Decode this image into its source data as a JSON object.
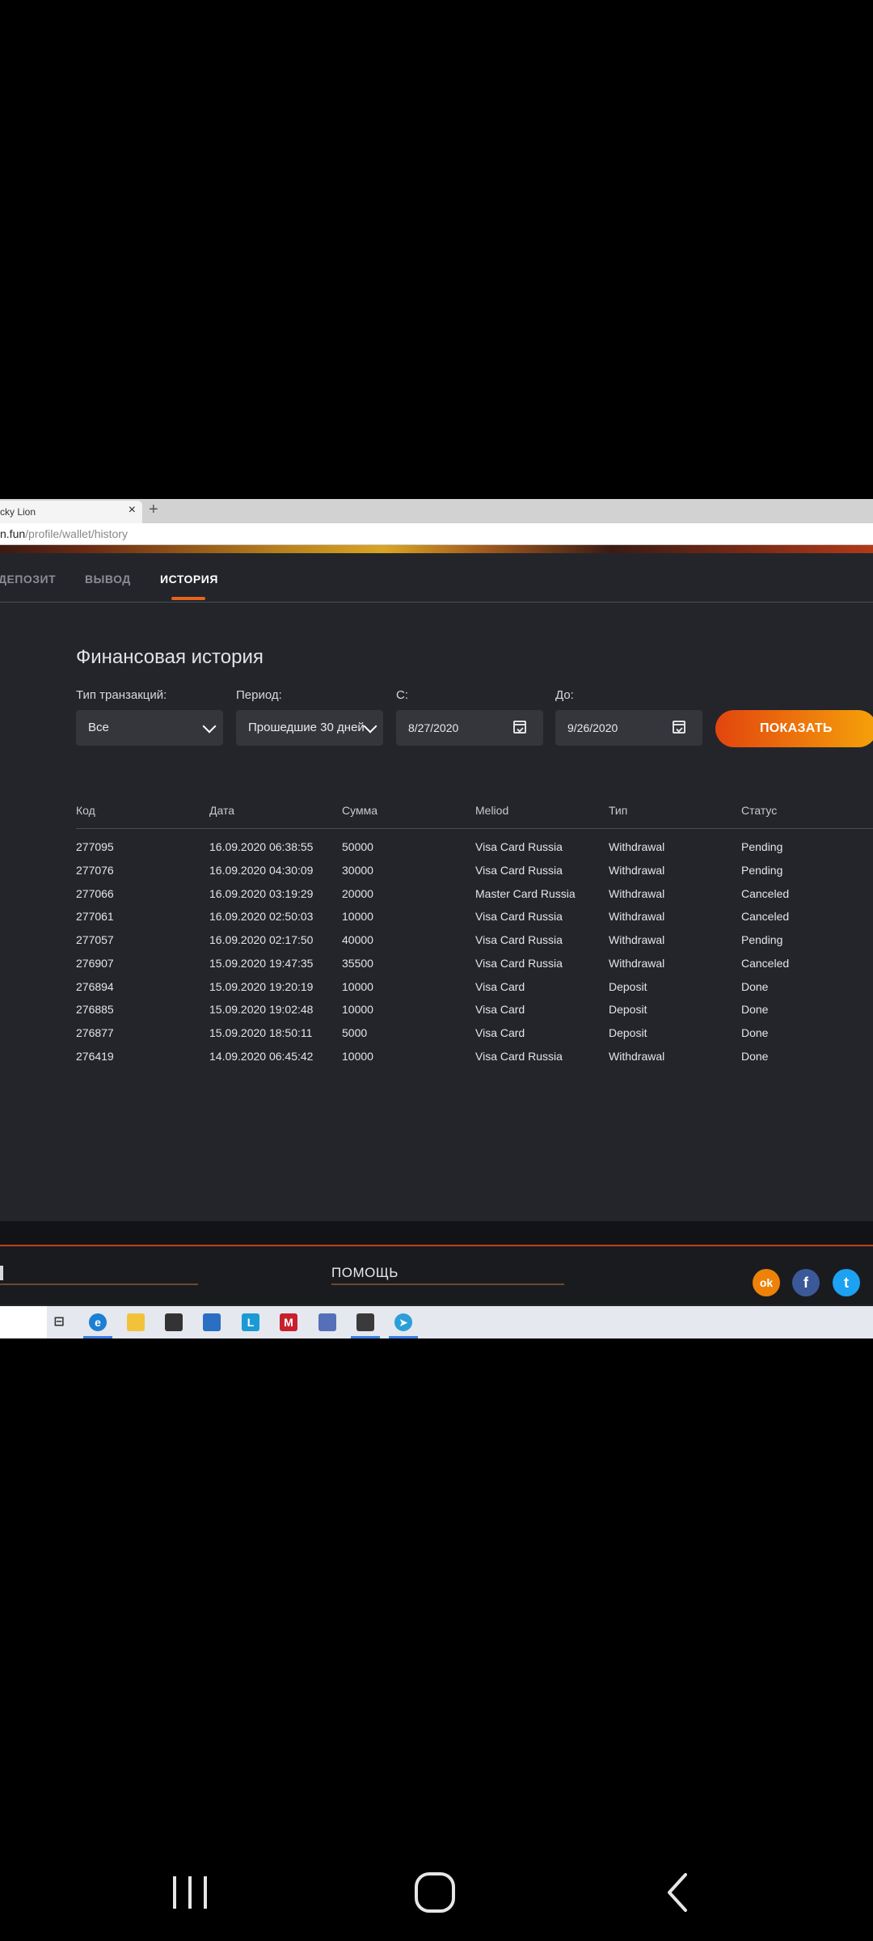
{
  "browser": {
    "tab_title": "cky Lion",
    "tab_close": "×",
    "new_tab": "+",
    "url_host": "n.fun",
    "url_path": "/profile/wallet/history"
  },
  "nav": {
    "items": [
      "ДЕПОЗИТ",
      "ВЫВОД",
      "ИСТОРИЯ"
    ],
    "active": "ИСТОРИЯ"
  },
  "page": {
    "title": "Финансовая история"
  },
  "filters": {
    "type_label": "Тип транзакций:",
    "type_value": "Все",
    "period_label": "Период:",
    "period_value": "Прошедшие 30 дней",
    "from_label": "С:",
    "from_value": "8/27/2020",
    "to_label": "До:",
    "to_value": "9/26/2020",
    "show_button": "ПОКАЗАТЬ"
  },
  "table": {
    "columns": [
      "Код",
      "Дата",
      "Сумма",
      "Meliod",
      "Тип",
      "Статус"
    ],
    "rows": [
      [
        "277095",
        "16.09.2020 06:38:55",
        "50000",
        "Visa Card Russia",
        "Withdrawal",
        "Pending"
      ],
      [
        "277076",
        "16.09.2020 04:30:09",
        "30000",
        "Visa Card Russia",
        "Withdrawal",
        "Pending"
      ],
      [
        "277066",
        "16.09.2020 03:19:29",
        "20000",
        "Master Card Russia",
        "Withdrawal",
        "Canceled"
      ],
      [
        "277061",
        "16.09.2020 02:50:03",
        "10000",
        "Visa Card Russia",
        "Withdrawal",
        "Canceled"
      ],
      [
        "277057",
        "16.09.2020 02:17:50",
        "40000",
        "Visa Card Russia",
        "Withdrawal",
        "Pending"
      ],
      [
        "276907",
        "15.09.2020 19:47:35",
        "35500",
        "Visa Card Russia",
        "Withdrawal",
        "Canceled"
      ],
      [
        "276894",
        "15.09.2020 19:20:19",
        "10000",
        "Visa Card",
        "Deposit",
        "Done"
      ],
      [
        "276885",
        "15.09.2020 19:02:48",
        "10000",
        "Visa Card",
        "Deposit",
        "Done"
      ],
      [
        "276877",
        "15.09.2020 18:50:11",
        "5000",
        "Visa Card",
        "Deposit",
        "Done"
      ],
      [
        "276419",
        "14.09.2020 06:45:42",
        "10000",
        "Visa Card Russia",
        "Withdrawal",
        "Done"
      ]
    ]
  },
  "footer": {
    "help_label": "ПОМОЩЬ",
    "social_icons": [
      "odnoklassniki-icon",
      "facebook-icon",
      "twitter-icon"
    ],
    "social_glyphs": [
      "ok",
      "f",
      "t"
    ]
  },
  "colors": {
    "accent": "#e8641c",
    "button_start": "#e2450e",
    "button_end": "#f5a20a",
    "odnoklassniki": "#ee8208",
    "facebook": "#3b5998",
    "twitter": "#1da1f2"
  }
}
